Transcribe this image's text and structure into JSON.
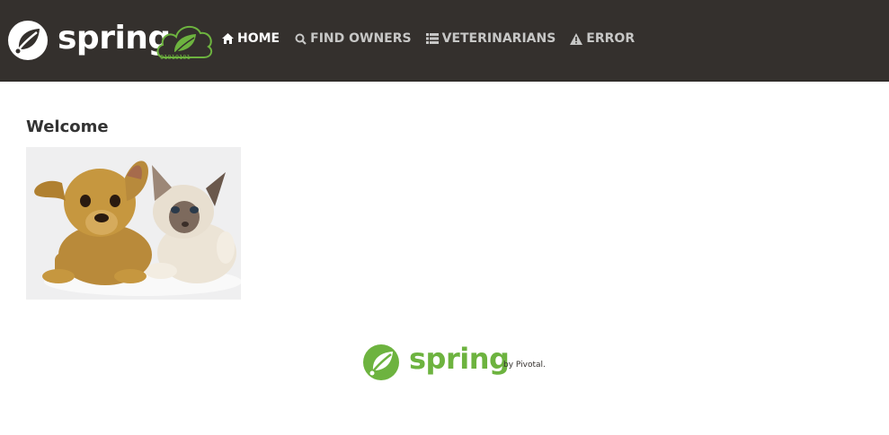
{
  "brand": {
    "name": "spring",
    "badge": "01010101"
  },
  "nav": {
    "items": [
      {
        "label": "HOME",
        "icon": "home-icon",
        "active": true
      },
      {
        "label": "FIND OWNERS",
        "icon": "search-icon",
        "active": false
      },
      {
        "label": "VETERINARIANS",
        "icon": "list-icon",
        "active": false
      },
      {
        "label": "ERROR",
        "icon": "warning-icon",
        "active": false
      }
    ]
  },
  "main": {
    "title": "Welcome",
    "image_alt": "puppy and kitten"
  },
  "footer": {
    "brand": "spring",
    "by": "by Pivotal."
  },
  "colors": {
    "navbar_bg": "#34302d",
    "accent": "#6db33f",
    "nav_text": "#c7c7c6",
    "nav_active": "#ffffff"
  }
}
